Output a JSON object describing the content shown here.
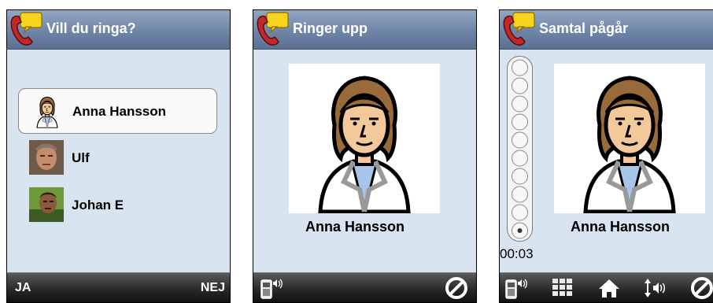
{
  "screens": [
    {
      "title": "Vill du ringa?",
      "contacts": [
        {
          "name": "Anna Hansson",
          "selected": true,
          "icon": "woman-pictogram-icon"
        },
        {
          "name": "Ulf",
          "selected": false,
          "icon": "ulf-photo"
        },
        {
          "name": "Johan E",
          "selected": false,
          "icon": "johan-photo"
        }
      ],
      "softkeys": {
        "left": "JA",
        "right": "NEJ"
      }
    },
    {
      "title": "Ringer upp",
      "caller_name": "Anna Hansson",
      "buttons": [
        "speakerphone-icon",
        "cancel-icon"
      ]
    },
    {
      "title": "Samtal pågår",
      "caller_name": "Anna Hansson",
      "volume": {
        "levels": 10,
        "current": 1
      },
      "timer": "00:03",
      "buttons": [
        "speakerphone-icon",
        "keypad-icon",
        "home-icon",
        "volume-icon",
        "cancel-icon"
      ]
    }
  ],
  "colors": {
    "title_bar": "#6f85a6",
    "screen_bg": "#d9e4f1",
    "bottom_bar": "#262626",
    "phone_red": "#c0282b",
    "bubble_yellow": "#f7d21e"
  }
}
